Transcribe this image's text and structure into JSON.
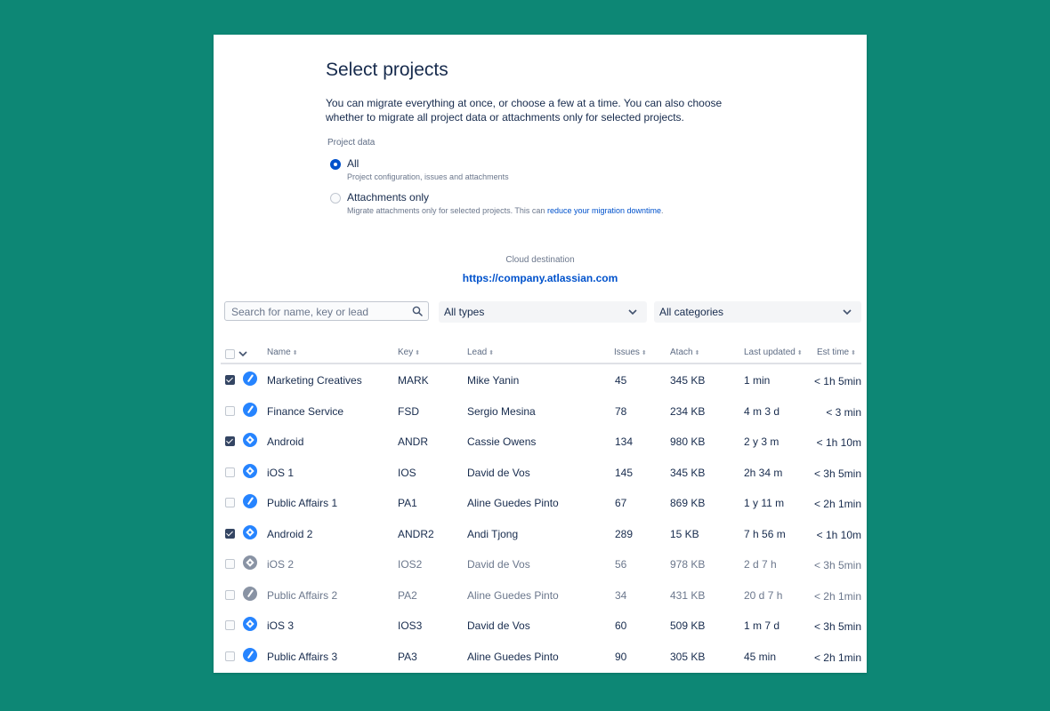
{
  "page": {
    "title": "Select projects",
    "description": "You can migrate everything at once, or choose a few at a time. You can also choose whether to migrate all project data or attachments only for selected projects."
  },
  "project_data": {
    "label": "Project data",
    "options": [
      {
        "label": "All",
        "help": "Project configuration, issues and attachments",
        "selected": true
      },
      {
        "label": "Attachments only",
        "help": "Migrate attachments only for selected projects. This can ",
        "help_link": "reduce your migration downtime",
        "help_suffix": ".",
        "selected": false
      }
    ]
  },
  "destination": {
    "label": "Cloud destination",
    "url": "https://company.atlassian.com"
  },
  "filters": {
    "search_placeholder": "Search for name, key or lead",
    "types": "All types",
    "categories": "All categories"
  },
  "table": {
    "headers": {
      "name": "Name",
      "key": "Key",
      "lead": "Lead",
      "issues": "Issues",
      "attach": "Atach",
      "updated": "Last updated",
      "est": "Est time"
    },
    "rows": [
      {
        "checked": true,
        "type": "business",
        "dim": false,
        "name": "Marketing Creatives",
        "key": "MARK",
        "lead": "Mike Yanin",
        "issues": "45",
        "attach": "345 KB",
        "updated": "1 min",
        "est": "< 1h 5min"
      },
      {
        "checked": false,
        "type": "business",
        "dim": false,
        "name": "Finance Service",
        "key": "FSD",
        "lead": "Sergio Mesina",
        "issues": "78",
        "attach": "234 KB",
        "updated": "4 m 3 d",
        "est": "< 3 min"
      },
      {
        "checked": true,
        "type": "software",
        "dim": false,
        "name": "Android",
        "key": "ANDR",
        "lead": "Cassie Owens",
        "issues": "134",
        "attach": "980 KB",
        "updated": "2 y 3 m",
        "est": "< 1h 10m"
      },
      {
        "checked": false,
        "type": "software",
        "dim": false,
        "name": "iOS 1",
        "key": "IOS",
        "lead": "David de Vos",
        "issues": "145",
        "attach": "345 KB",
        "updated": "2h 34 m",
        "est": "< 3h 5min"
      },
      {
        "checked": false,
        "type": "business",
        "dim": false,
        "name": "Public Affairs 1",
        "key": "PA1",
        "lead": "Aline Guedes Pinto",
        "issues": "67",
        "attach": "869 KB",
        "updated": "1 y 11 m",
        "est": "< 2h 1min"
      },
      {
        "checked": true,
        "type": "software",
        "dim": false,
        "name": "Android 2",
        "key": "ANDR2",
        "lead": "Andi Tjong",
        "issues": "289",
        "attach": "15 KB",
        "updated": "7 h 56 m",
        "est": "< 1h 10m"
      },
      {
        "checked": false,
        "type": "software",
        "dim": true,
        "name": "iOS 2",
        "key": "IOS2",
        "lead": "David de Vos",
        "issues": "56",
        "attach": "978 KB",
        "updated": "2 d 7 h",
        "est": "< 3h 5min"
      },
      {
        "checked": false,
        "type": "business",
        "dim": true,
        "name": "Public Affairs 2",
        "key": "PA2",
        "lead": "Aline Guedes Pinto",
        "issues": "34",
        "attach": "431 KB",
        "updated": "20 d 7 h",
        "est": "< 2h 1min"
      },
      {
        "checked": false,
        "type": "software",
        "dim": false,
        "name": "iOS 3",
        "key": "IOS3",
        "lead": "David de Vos",
        "issues": "60",
        "attach": "509 KB",
        "updated": "1 m 7 d",
        "est": "< 3h 5min"
      },
      {
        "checked": false,
        "type": "business",
        "dim": false,
        "name": "Public Affairs 3",
        "key": "PA3",
        "lead": "Aline Guedes Pinto",
        "issues": "90",
        "attach": "305 KB",
        "updated": "45 min",
        "est": "< 2h 1min"
      }
    ]
  },
  "colors": {
    "background": "#0d8775",
    "accent": "#0052cc",
    "project_icon": "#2684ff",
    "project_icon_dim": "#8993a4"
  }
}
